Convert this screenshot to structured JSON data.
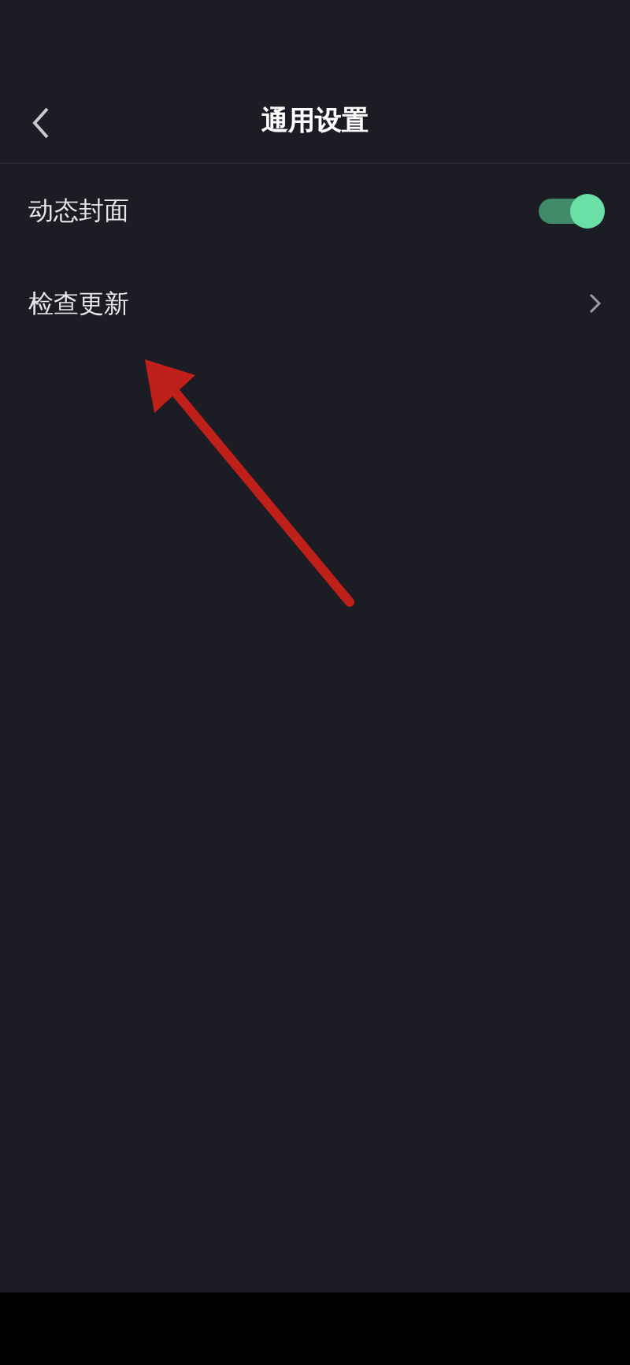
{
  "header": {
    "title": "通用设置"
  },
  "settings": [
    {
      "kind": "toggle",
      "label": "动态封面",
      "on": true
    },
    {
      "kind": "link",
      "label": "检查更新"
    }
  ]
}
